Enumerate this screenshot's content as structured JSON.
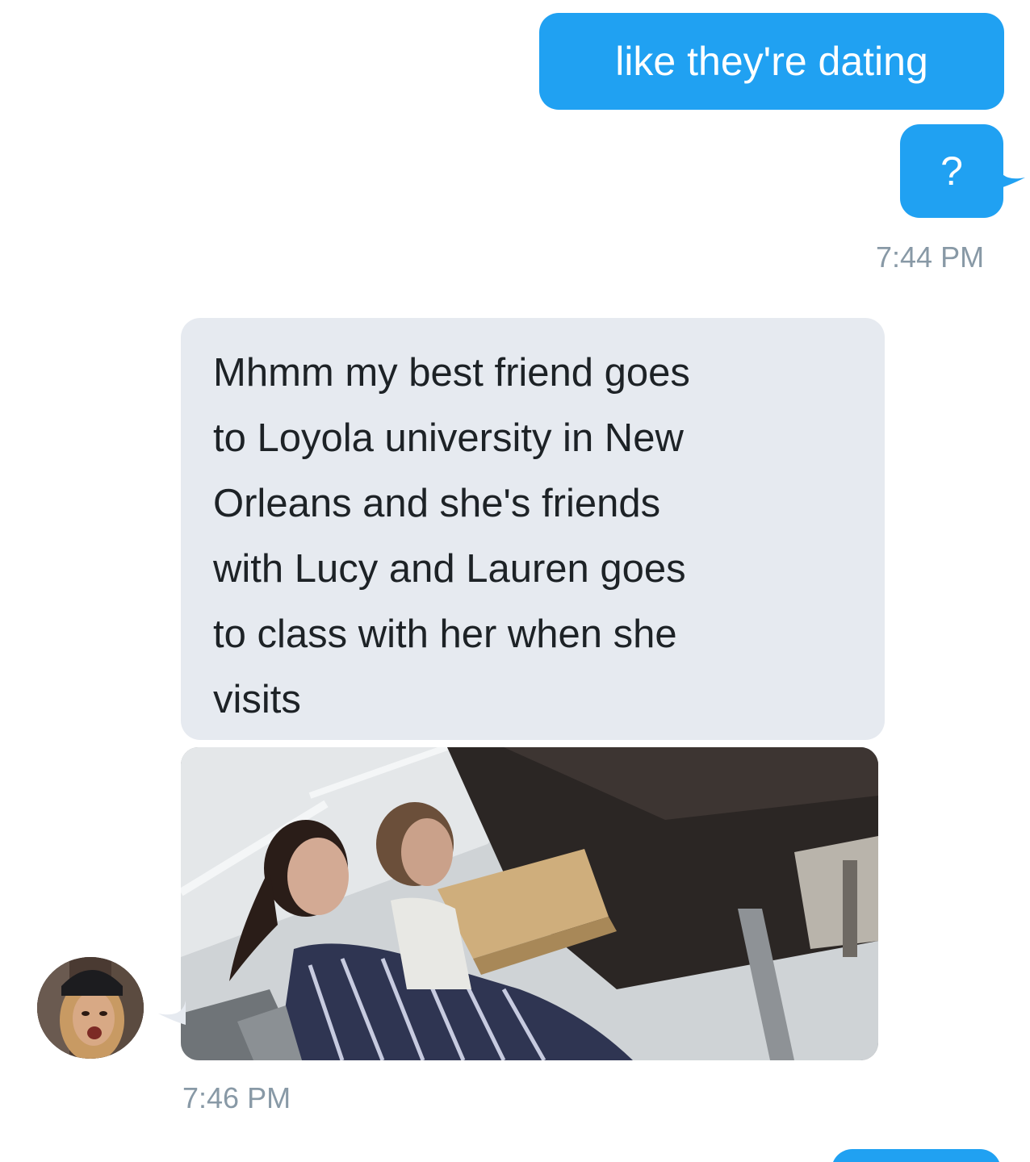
{
  "colors": {
    "sent_bubble": "#20a1f2",
    "received_bubble": "#e6eaf0",
    "timestamp": "#8899a6",
    "background": "#ffffff"
  },
  "messages": {
    "sent_1": "like they're dating",
    "sent_2": "?",
    "time_1": "7:44 PM",
    "received_1_lines": [
      "Mhmm my best friend goes",
      "to Loyola university in New",
      "Orleans and she's friends",
      "with Lucy and Lauren goes",
      "to class with her when she",
      "visits"
    ],
    "time_2": "7:46 PM"
  },
  "attachments": {
    "received_photo": "photo-attachment",
    "avatar": "user-avatar"
  }
}
